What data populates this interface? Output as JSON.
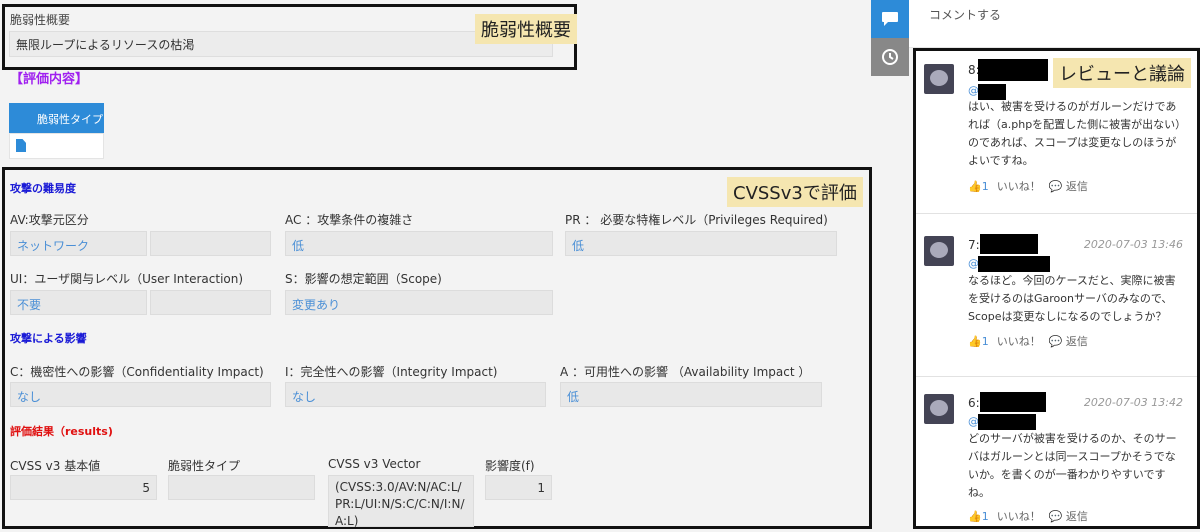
{
  "summary": {
    "label": "脆弱性概要",
    "value": "無限ループによるリソースの枯渇",
    "annotation": "脆弱性概要"
  },
  "eval_heading": "【評価内容】",
  "vuln_type_tab": "脆弱性タイプ",
  "cvss_annotation": "CVSSv3で評価",
  "attack_difficulty": {
    "title": "攻撃の難易度",
    "av_label": "AV:攻撃元区分",
    "av_value": "ネットワーク",
    "ac_label": "AC ：攻撃条件の複雑さ",
    "ac_value": "低",
    "pr_label": "PR ： 必要な特権レベル（Privileges Required)",
    "pr_value": "低",
    "ui_label": "UI：ユーザ関与レベル（User Interaction)",
    "ui_value": "不要",
    "s_label": "S：影響の想定範囲（Scope)",
    "s_value": "変更あり"
  },
  "attack_impact": {
    "title": "攻撃による影響",
    "c_label": "C：機密性への影響（Confidentiality Impact)",
    "c_value": "なし",
    "i_label": "I：完全性への影響（Integrity Impact)",
    "i_value": "なし",
    "a_label": "A ：可用性への影響 （Availability Impact ）",
    "a_value": "低"
  },
  "results": {
    "title": "評価結果（results)",
    "base_label": "CVSS v3 基本値",
    "base_value": "5",
    "type_label": "脆弱性タイプ",
    "vector_label": "CVSS v3 Vector",
    "vector_value": "(CVSS:3.0/AV:N/AC:L/PR:L/UI:N/S:C/C:N/I:N/A:L)",
    "impact_label": "影響度(f)",
    "impact_value": "1"
  },
  "side": {
    "comment_button": "コメントする",
    "review_annotation": "レビューと議論"
  },
  "comments": [
    {
      "num": "8:",
      "time": "",
      "at": "@",
      "text": "はい、被害を受けるのがガルーンだけであれば（a.phpを配置した側に被害が出ない）のであれば、スコープは変更なしのほうがよいですね。",
      "likes": "1",
      "like_label": "いいね！",
      "reply_label": "返信"
    },
    {
      "num": "7:",
      "time": "2020-07-03 13:46",
      "at": "@",
      "text": "なるほど。今回のケースだと、実際に被害を受けるのはGaroonサーバのみなので、Scopeは変更なしになるのでしょうか？",
      "likes": "1",
      "like_label": "いいね！",
      "reply_label": "返信"
    },
    {
      "num": "6:",
      "time": "2020-07-03 13:42",
      "at": "@",
      "text": "どのサーバが被害を受けるのか、そのサーバはガルーンとは同一スコープかそうでないか。を書くのが一番わかりやすいですね。",
      "likes": "1",
      "like_label": "いいね！",
      "reply_label": "返信"
    }
  ],
  "colors": {
    "accent_blue": "#2d8bd8",
    "annotation_bg": "#f5e6b0",
    "eval_purple": "#a020f0",
    "section_blue": "#1a1ad6",
    "result_red": "#e01010"
  }
}
